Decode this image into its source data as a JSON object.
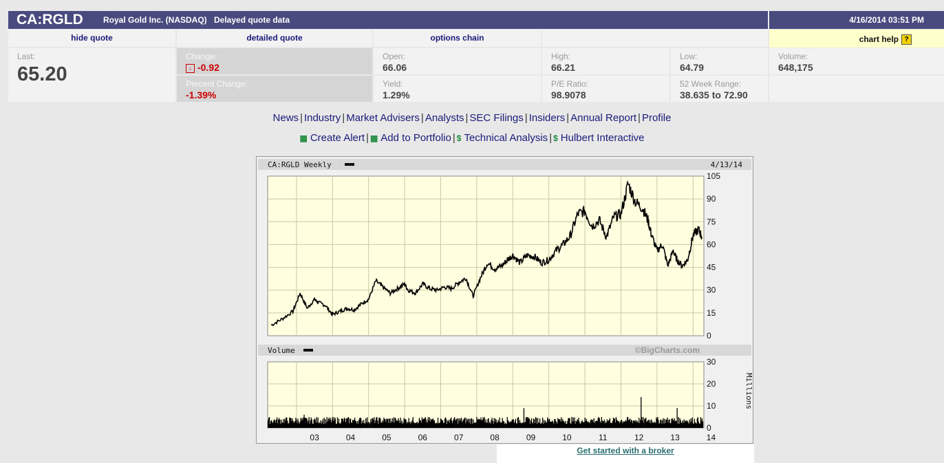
{
  "header": {
    "ticker": "CA:RGLD",
    "company": "Royal Gold Inc. (NASDAQ)",
    "delayed": "Delayed quote data",
    "datetime": "4/16/2014 03:51 PM"
  },
  "tabs": {
    "hide_quote": "hide quote",
    "detailed_quote": "detailed quote",
    "options_chain": "options chain",
    "chart_help": "chart help",
    "chart_help_icon": "?"
  },
  "quote": {
    "last_label": "Last:",
    "last": "65.20",
    "change_label": "Change:",
    "change": "-0.92",
    "pct_label": "Percent Change:",
    "pct": "-1.39%",
    "open_label": "Open:",
    "open": "66.06",
    "yield_label": "Yield:",
    "yield": "1.29%",
    "high_label": "High:",
    "high": "66.21",
    "pe_label": "P/E Ratio:",
    "pe": "98.9078",
    "low_label": "Low:",
    "low": "64.79",
    "range_label": "52 Week Range:",
    "range": "38.635 to 72.90",
    "volume_label": "Volume:",
    "volume": "648,175"
  },
  "links": {
    "row1": [
      "News",
      "Industry",
      "Market Advisers",
      "Analysts",
      "SEC Filings",
      "Insiders",
      "Annual Report",
      "Profile"
    ],
    "row2": [
      "Create Alert",
      "Add to Portfolio",
      "Technical Analysis",
      "Hulbert Interactive"
    ],
    "separator": "|"
  },
  "chart_data": {
    "type": "line",
    "title": "CA:RGLD Weekly",
    "date": "4/13/14",
    "watermark": "©BigCharts.com",
    "price": {
      "ylim": [
        0,
        105
      ],
      "yticks": [
        "105",
        "90",
        "75",
        "60",
        "45",
        "30",
        "15",
        "0"
      ],
      "x": [
        2002.3,
        2002.6,
        2002.9,
        2003.1,
        2003.3,
        2003.5,
        2003.6,
        2003.8,
        2004.0,
        2004.2,
        2004.4,
        2004.6,
        2004.8,
        2005.0,
        2005.2,
        2005.4,
        2005.6,
        2005.8,
        2006.0,
        2006.1,
        2006.3,
        2006.5,
        2006.7,
        2006.9,
        2007.1,
        2007.3,
        2007.5,
        2007.7,
        2007.9,
        2008.1,
        2008.3,
        2008.5,
        2008.7,
        2008.85,
        2009.0,
        2009.2,
        2009.4,
        2009.6,
        2009.8,
        2010.0,
        2010.2,
        2010.4,
        2010.6,
        2010.8,
        2011.0,
        2011.2,
        2011.4,
        2011.6,
        2011.8,
        2012.0,
        2012.2,
        2012.4,
        2012.6,
        2012.75,
        2012.85,
        2013.0,
        2013.15,
        2013.3,
        2013.45,
        2013.55,
        2013.7,
        2013.85,
        2014.0,
        2014.15,
        2014.25
      ],
      "values": [
        7,
        11,
        16,
        28,
        18,
        24,
        22,
        20,
        14,
        16,
        18,
        17,
        21,
        24,
        36,
        32,
        28,
        31,
        34,
        30,
        28,
        34,
        31,
        30,
        32,
        31,
        35,
        38,
        26,
        38,
        48,
        44,
        46,
        50,
        53,
        48,
        53,
        52,
        48,
        50,
        56,
        60,
        66,
        80,
        82,
        72,
        76,
        65,
        78,
        80,
        100,
        88,
        84,
        76,
        66,
        56,
        60,
        46,
        56,
        50,
        46,
        50,
        66,
        70,
        65
      ]
    },
    "volume": {
      "label": "Volume",
      "unit": "Millions",
      "ylim": [
        0,
        30
      ],
      "yticks": [
        "30",
        "20",
        "10",
        "0"
      ],
      "spikes": [
        {
          "x": 2012.55,
          "v": 14
        },
        {
          "x": 2009.3,
          "v": 9
        },
        {
          "x": 2013.55,
          "v": 9
        },
        {
          "x": 2003.2,
          "v": 6
        }
      ]
    },
    "xticks": [
      "03",
      "04",
      "05",
      "06",
      "07",
      "08",
      "09",
      "10",
      "11",
      "12",
      "13",
      "14"
    ]
  },
  "footer": {
    "broker": "Get started with a broker"
  }
}
